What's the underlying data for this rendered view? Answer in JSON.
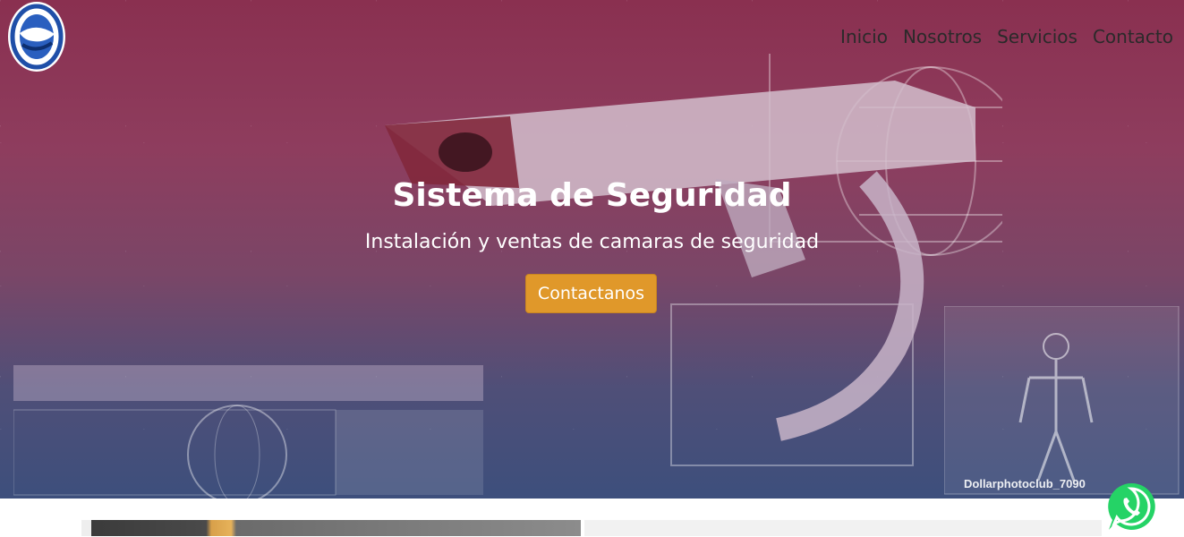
{
  "brand": {
    "logo_icon": "globe-swirl-logo-icon"
  },
  "nav": {
    "items": [
      {
        "label": "Inicio"
      },
      {
        "label": "Nosotros"
      },
      {
        "label": "Servicios"
      },
      {
        "label": "Contacto"
      }
    ]
  },
  "hero": {
    "title": "Sistema de Seguridad",
    "subtitle": "Instalación y ventas de camaras de seguridad",
    "cta_label": "Contactanos",
    "watermark": "Dollarphotoclub_7090",
    "background_icon": "security-camera-icon"
  },
  "floating": {
    "icon": "whatsapp-icon"
  },
  "colors": {
    "accent": "#e0982a",
    "hero_top": "#8a3050",
    "hero_bottom": "#3d4f7c",
    "logo_blue": "#1f4fa8",
    "whatsapp_green": "#25d366"
  }
}
